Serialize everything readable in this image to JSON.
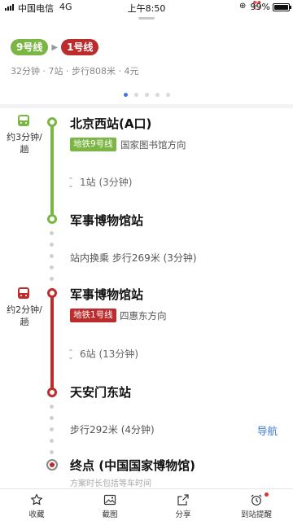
{
  "status_bar": {
    "carrier": "中国电信",
    "network": "4G",
    "time": "上午8:50",
    "icons": "⊕ ⏰",
    "battery_percent": "99%",
    "battery_level": 0.99
  },
  "summary": {
    "lines": [
      "9号线",
      "1号线"
    ],
    "meta": "32分钟 · 7站 · 步行808米 · 4元",
    "pages": 5,
    "current_page": 1
  },
  "segments": {
    "seg1": {
      "time_label": "约3分钟/趟",
      "board_station": "北京西站(A口)",
      "line_badge": "地铁9号线",
      "direction": "国家图书馆方向",
      "stops": "1站 (3分钟)",
      "alight_station": "军事博物馆站"
    },
    "transfer": "站内换乘 步行269米 (3分钟)",
    "seg2": {
      "time_label": "约2分钟/趟",
      "board_station": "军事博物馆站",
      "line_badge": "地铁1号线",
      "direction": "四惠东方向",
      "stops": "6站 (13分钟)",
      "alight_station": "天安门东站"
    },
    "final_walk": "步行292米 (4分钟)",
    "nav_label": "导航",
    "end_title": "终点 (中国国家博物馆)",
    "end_note": "方案时长包括等车时间"
  },
  "bottom_bar": {
    "collect": "收藏",
    "screenshot": "截图",
    "share": "分享",
    "alarm": "到站提醒"
  },
  "colors": {
    "line9": "#7bb543",
    "line1": "#bd2c2c",
    "accent": "#3a7ad9"
  }
}
